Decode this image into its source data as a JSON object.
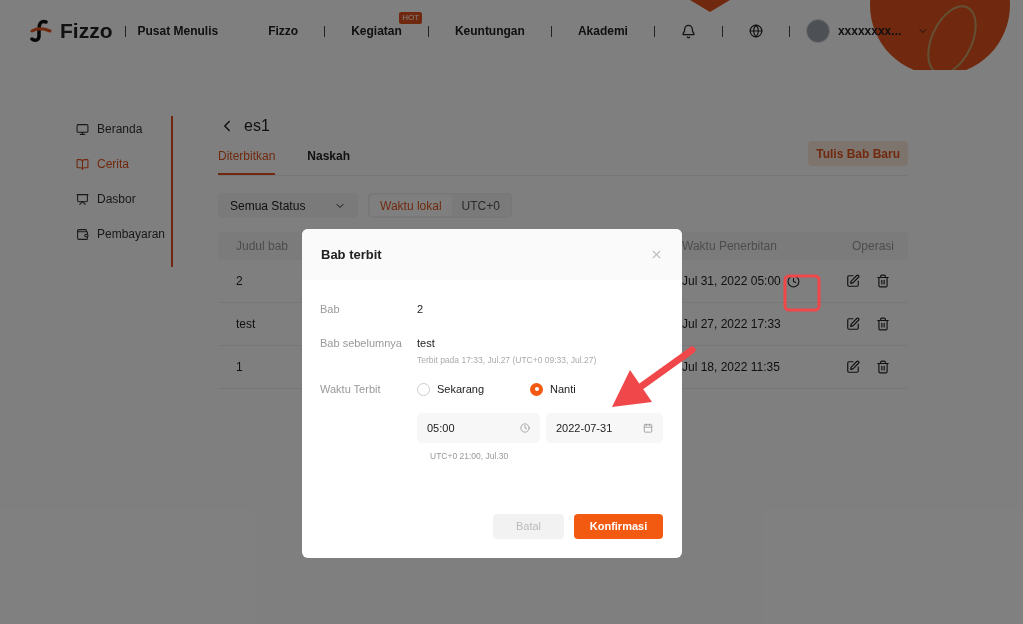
{
  "header": {
    "logo": "Fizzo",
    "subtitle": "Pusat Menulis",
    "nav": [
      {
        "label": "Fizzo"
      },
      {
        "label": "Kegiatan",
        "badge": "HOT"
      },
      {
        "label": "Keuntungan"
      },
      {
        "label": "Akademi"
      }
    ],
    "user_name": "xxxxxxxx..."
  },
  "sidebar": {
    "items": [
      {
        "label": "Beranda",
        "selected": false
      },
      {
        "label": "Cerita",
        "selected": true
      },
      {
        "label": "Dasbor",
        "selected": false
      },
      {
        "label": "Pembayaran",
        "selected": false
      }
    ]
  },
  "page": {
    "title": "es1",
    "tabs": [
      {
        "label": "Diterbitkan",
        "selected": true
      },
      {
        "label": "Naskah",
        "selected": false
      }
    ],
    "new_button": "Tulis Bab Baru",
    "status_filter": "Semua Status",
    "timezone": [
      {
        "label": "Waktu lokal",
        "selected": true
      },
      {
        "label": "UTC+0",
        "selected": false
      }
    ],
    "table": {
      "columns": [
        "Judul bab",
        "Waktu Penerbitan",
        "Operasi"
      ],
      "rows": [
        {
          "title": "2",
          "publish_time": "Jul 31, 2022 05:00",
          "scheduled": true
        },
        {
          "title": "test",
          "publish_time": "Jul 27, 2022 17:33",
          "scheduled": false
        },
        {
          "title": "1",
          "publish_time": "Jul 18, 2022 11:35",
          "scheduled": false
        }
      ]
    }
  },
  "modal": {
    "title": "Bab terbit",
    "chapter": {
      "label": "Bab",
      "value": "2"
    },
    "previous": {
      "label": "Bab sebelumnya",
      "value": "test",
      "note": "Terbit pada 17:33, Jul.27 (UTC+0 09:33, Jul.27)"
    },
    "publish": {
      "label": "Waktu Terbit",
      "options": [
        {
          "label": "Sekarang",
          "selected": false
        },
        {
          "label": "Nanti",
          "selected": true
        }
      ],
      "time": "05:00",
      "date": "2022-07-31",
      "utc_note": "UTC+0 21:00, Jul.30"
    },
    "cancel": {
      "label": "Batal",
      "disabled": true
    },
    "confirm": {
      "label": "Konfirmasi"
    }
  }
}
